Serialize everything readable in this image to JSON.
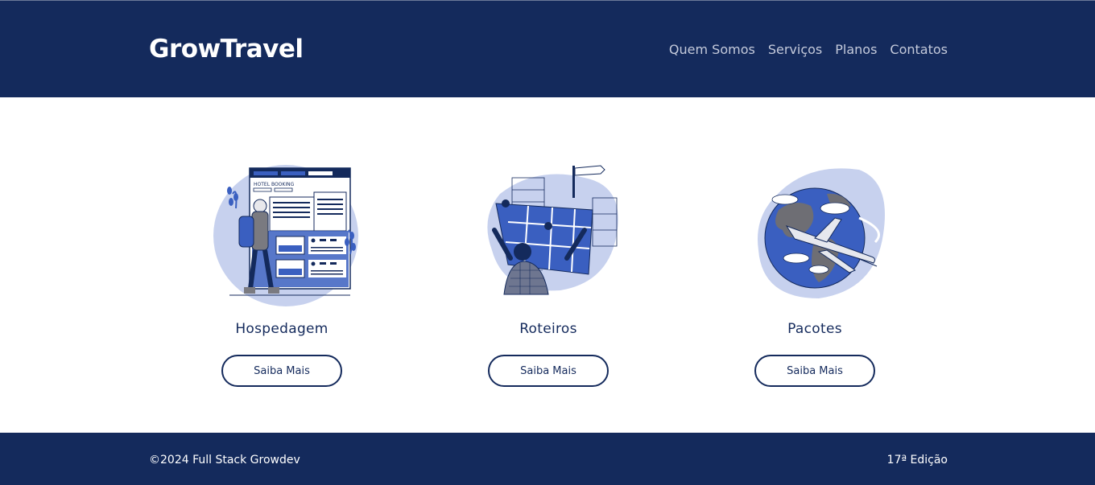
{
  "header": {
    "logo": "GrowTravel",
    "nav": [
      "Quem Somos",
      "Serviços",
      "Planos",
      "Contatos"
    ]
  },
  "services": [
    {
      "title": "Hospedagem",
      "button": "Saiba Mais",
      "illustration_text": "HOTEL BOOKING",
      "icon": "hotel-booking-illustration"
    },
    {
      "title": "Roteiros",
      "button": "Saiba Mais",
      "icon": "map-reading-illustration"
    },
    {
      "title": "Pacotes",
      "button": "Saiba Mais",
      "icon": "globe-airplane-illustration"
    }
  ],
  "footer": {
    "copyright": "©2024 Full Stack Growdev",
    "edition": "17ª Edição"
  },
  "colors": {
    "navy": "#142a5c",
    "accent_blue": "#3a5fc0",
    "light_blue": "#c7d1ee",
    "nav_text": "#c4cadb"
  }
}
